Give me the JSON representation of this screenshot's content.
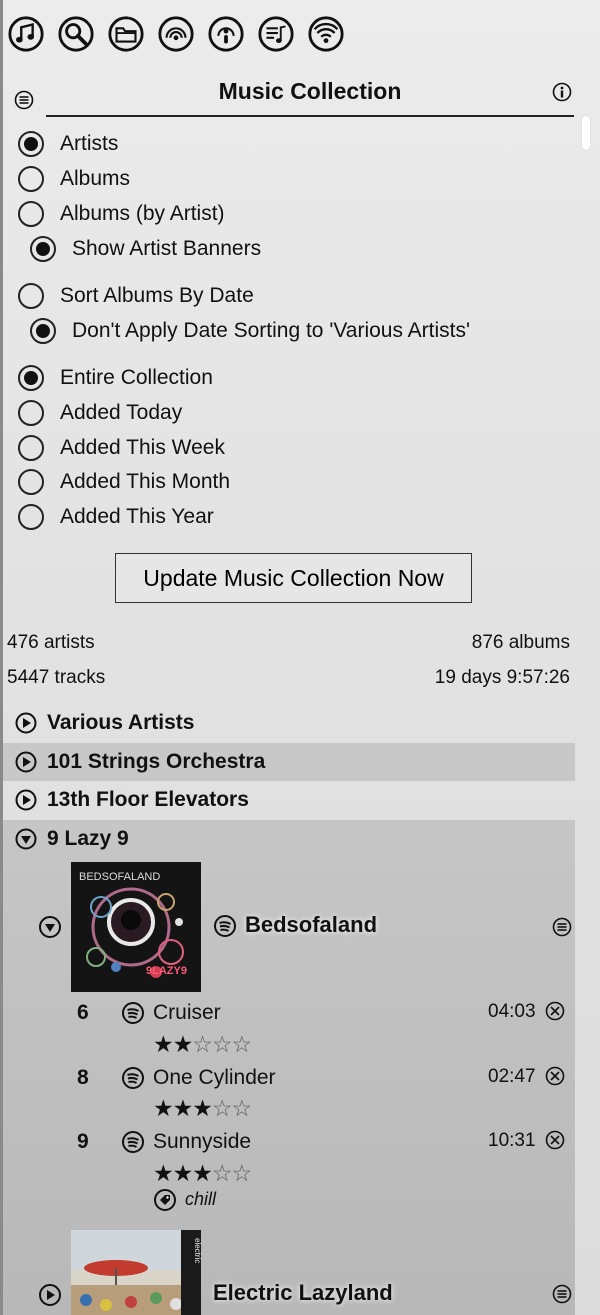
{
  "header": {
    "title": "Music Collection"
  },
  "toolbar": {
    "icons": [
      "music-note-icon",
      "search-icon",
      "folder-icon",
      "radio-waves-icon",
      "podcast-icon",
      "playlist-icon",
      "wifi-icon"
    ]
  },
  "view_options": [
    "Artists",
    "Albums",
    "Albums (by Artist)"
  ],
  "view_selected": "Artists",
  "show_banners": "Show Artist Banners",
  "sort_by_date": "Sort Albums By Date",
  "no_date_various": "Don't Apply Date Sorting to 'Various Artists'",
  "range_options": [
    "Entire Collection",
    "Added Today",
    "Added This Week",
    "Added This Month",
    "Added This Year"
  ],
  "range_selected": "Entire Collection",
  "update_button": "Update Music Collection Now",
  "stats": {
    "artists": "476 artists",
    "albums": "876 albums",
    "tracks": "5447 tracks",
    "duration": "19 days 9:57:26"
  },
  "artists": [
    "Various Artists",
    "101 Strings Orchestra",
    "13th Floor Elevators",
    "9 Lazy 9"
  ],
  "albums": [
    {
      "title": "Bedsofaland",
      "cover_text": [
        "BEDSOFALAND",
        "9LAZY9"
      ],
      "tracks": [
        {
          "num": "6",
          "title": "Cruiser",
          "duration": "04:03",
          "rating": 2
        },
        {
          "num": "8",
          "title": "One Cylinder",
          "duration": "02:47",
          "rating": 3
        },
        {
          "num": "9",
          "title": "Sunnyside",
          "duration": "10:31",
          "rating": 3,
          "tag": "chill"
        }
      ]
    },
    {
      "title": "Electric Lazyland",
      "cover_text": [
        "electric"
      ]
    }
  ],
  "colors": {
    "selected_row": "#c8c8c8",
    "expanded_bg": "#bcbcbc"
  }
}
